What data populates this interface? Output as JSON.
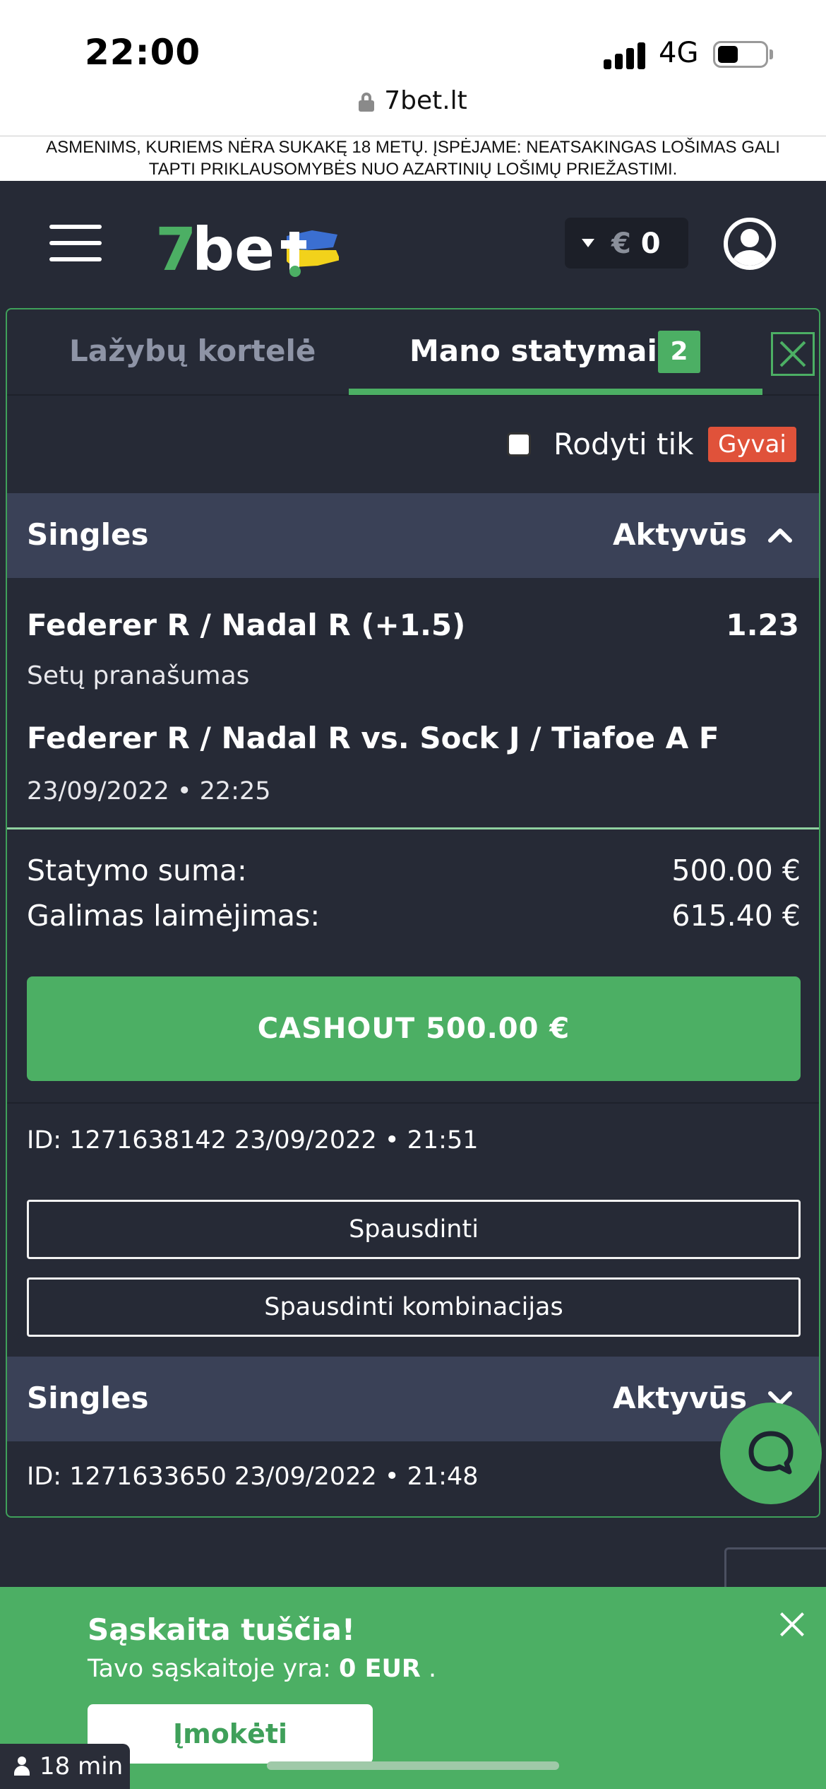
{
  "status_bar": {
    "time": "22:00",
    "network": "4G"
  },
  "browser": {
    "url": "7bet.lt"
  },
  "warning": {
    "text": "ASMENIMS, KURIEMS NĖRA SUKAKĘ 18 METŲ. ĮSPĖJAME: NEATSAKINGAS LOŠIMAS GALI TAPTI PRIKLAUSOMYBĖS NUO AZARTINIŲ LOŠIMŲ PRIEŽASTIMI."
  },
  "header": {
    "logo_text": "7bet",
    "balance_currency": "€",
    "balance_amount": "0"
  },
  "tabs": {
    "betslip": "Lažybų kortelė",
    "my_bets": "Mano statymai",
    "my_bets_count": "2"
  },
  "filter": {
    "label": "Rodyti tik",
    "live_badge": "Gyvai"
  },
  "bets": [
    {
      "type": "Singles",
      "status": "Aktyvūs",
      "selection": "Federer R / Nadal R (+1.5)",
      "odds": "1.23",
      "market": "Setų pranašumas",
      "event": "Federer R / Nadal R vs. Sock J / Tiafoe A F",
      "event_datetime": "23/09/2022 • 22:25",
      "stake_label": "Statymo suma:",
      "stake_value": "500.00 €",
      "potential_label": "Galimas laimėjimas:",
      "potential_value": "615.40 €",
      "cashout_label": "CASHOUT 500.00 €",
      "id_line": "ID: 1271638142  23/09/2022 • 21:51",
      "print_label": "Spausdinti",
      "print_combos_label": "Spausdinti kombinacijas"
    },
    {
      "type": "Singles",
      "status": "Aktyvūs",
      "id_line": "ID: 1271633650  23/09/2022 • 21:48"
    }
  ],
  "notice": {
    "title": "Sąskaita tuščia!",
    "text_prefix": "Tavo sąskaitoje yra:",
    "text_amount": "0 EUR",
    "text_suffix": ".",
    "deposit_label": "Įmokėti"
  },
  "session_timer": "18 min",
  "colors": {
    "brand_green": "#4caf64",
    "header_bg": "#262a36",
    "section_bg": "#3a4157",
    "live_red": "#e0523a"
  }
}
